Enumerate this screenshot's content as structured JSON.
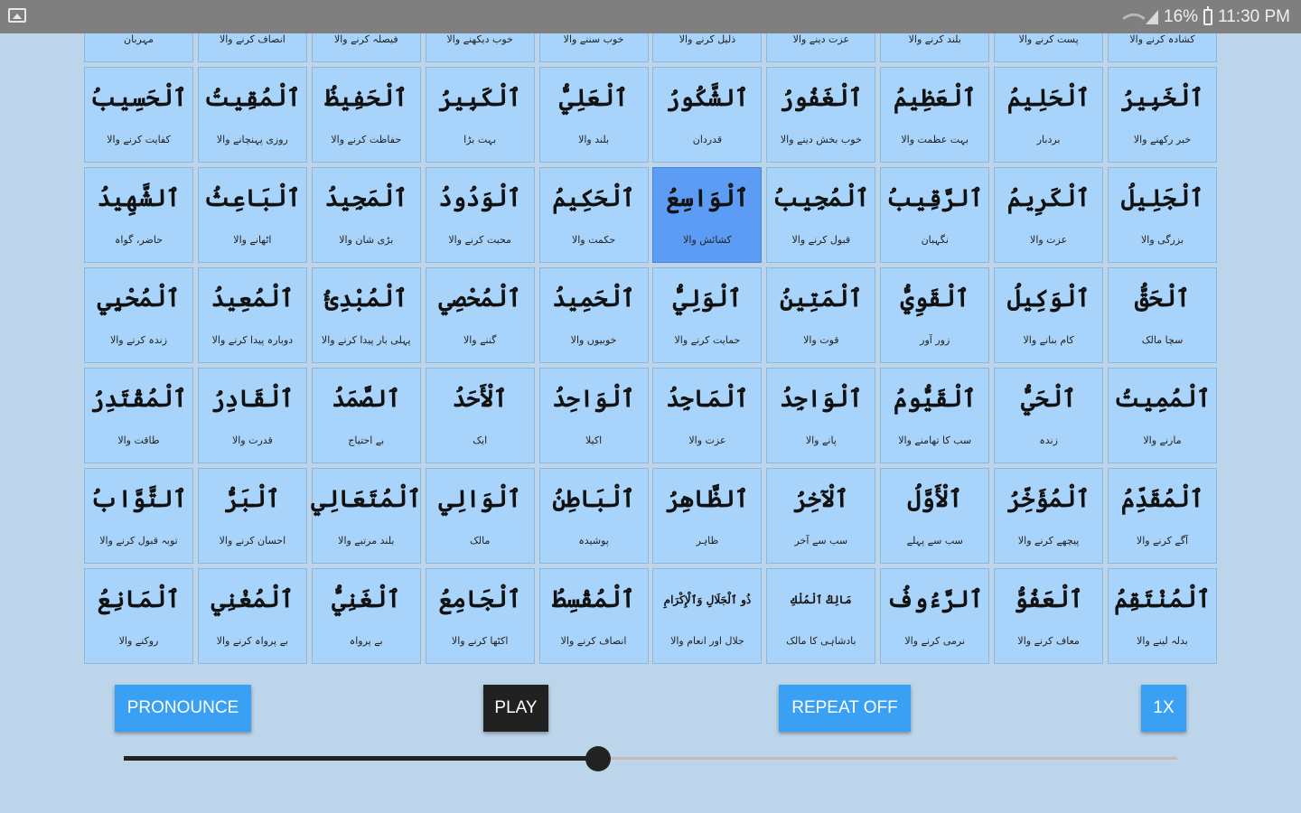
{
  "status_bar": {
    "battery": "16%",
    "time": "11:30 PM"
  },
  "grid": {
    "cells": [
      {
        "name": "",
        "meaning": "مہربان"
      },
      {
        "name": "",
        "meaning": "انصاف کرنے والا"
      },
      {
        "name": "",
        "meaning": "فیصلہ کرنے والا"
      },
      {
        "name": "",
        "meaning": "خوب دیکھنے والا"
      },
      {
        "name": "",
        "meaning": "خوب سننے والا"
      },
      {
        "name": "",
        "meaning": "ذلیل کرنے والا"
      },
      {
        "name": "",
        "meaning": "عزت دینے والا"
      },
      {
        "name": "",
        "meaning": "بلند کرنے والا"
      },
      {
        "name": "",
        "meaning": "پست کرنے والا"
      },
      {
        "name": "",
        "meaning": "کشادہ کرنے والا"
      },
      {
        "name": "ٱلْحَسِيبُ",
        "meaning": "کفایت کرنے والا"
      },
      {
        "name": "ٱلْمُقِيتُ",
        "meaning": "روزی پہنچانے والا"
      },
      {
        "name": "ٱلْحَفِيظُ",
        "meaning": "حفاظت کرنے والا"
      },
      {
        "name": "ٱلْكَبِيرُ",
        "meaning": "بہت بڑا"
      },
      {
        "name": "ٱلْعَلِيُّ",
        "meaning": "بلند والا"
      },
      {
        "name": "ٱلشَّكُورُ",
        "meaning": "قدردان"
      },
      {
        "name": "ٱلْغَفُورُ",
        "meaning": "خوب بخش دینے والا"
      },
      {
        "name": "ٱلْعَظِيمُ",
        "meaning": "بہت عظمت والا"
      },
      {
        "name": "ٱلْحَلِيمُ",
        "meaning": "بردبار"
      },
      {
        "name": "ٱلْخَبِيرُ",
        "meaning": "خبر رکھنے والا"
      },
      {
        "name": "ٱلشَّهِيدُ",
        "meaning": "حاضر، گواہ"
      },
      {
        "name": "ٱلْبَاعِثُ",
        "meaning": "اٹھانے والا"
      },
      {
        "name": "ٱلْمَجِيدُ",
        "meaning": "بڑی شان والا"
      },
      {
        "name": "ٱلْوَدُودُ",
        "meaning": "محبت کرنے والا"
      },
      {
        "name": "ٱلْحَكِيمُ",
        "meaning": "حکمت والا"
      },
      {
        "name": "ٱلْوَاسِعُ",
        "meaning": "کشائش والا"
      },
      {
        "name": "ٱلْمُجِيبُ",
        "meaning": "قبول کرنے والا"
      },
      {
        "name": "ٱلرَّقِيبُ",
        "meaning": "نگہبان"
      },
      {
        "name": "ٱلْكَرِيمُ",
        "meaning": "عزت والا"
      },
      {
        "name": "ٱلْجَلِيلُ",
        "meaning": "بزرگی والا"
      },
      {
        "name": "ٱلْمُحْيِي",
        "meaning": "زندہ کرنے والا"
      },
      {
        "name": "ٱلْمُعِيدُ",
        "meaning": "دوبارہ پیدا کرنے والا"
      },
      {
        "name": "ٱلْمُبْدِئُ",
        "meaning": "پہلی بار پیدا کرنے والا"
      },
      {
        "name": "ٱلْمُحْصِي",
        "meaning": "گننے والا"
      },
      {
        "name": "ٱلْحَمِيدُ",
        "meaning": "خوبیوں والا"
      },
      {
        "name": "ٱلْوَلِيُّ",
        "meaning": "حمایت کرنے والا"
      },
      {
        "name": "ٱلْمَتِينُ",
        "meaning": "قوت والا"
      },
      {
        "name": "ٱلْقَوِيُّ",
        "meaning": "زور آور"
      },
      {
        "name": "ٱلْوَكِيلُ",
        "meaning": "کام بنانے والا"
      },
      {
        "name": "ٱلْحَقُّ",
        "meaning": "سچا مالک"
      },
      {
        "name": "ٱلْمُقْتَدِرُ",
        "meaning": "طاقت والا"
      },
      {
        "name": "ٱلْقَادِرُ",
        "meaning": "قدرت والا"
      },
      {
        "name": "ٱلصَّمَدُ",
        "meaning": "بے احتیاج"
      },
      {
        "name": "ٱلْأَحَدُ",
        "meaning": "ایک"
      },
      {
        "name": "ٱلْوَاحِدُ",
        "meaning": "اکیلا"
      },
      {
        "name": "ٱلْمَاجِدُ",
        "meaning": "عزت والا"
      },
      {
        "name": "ٱلْوَاجِدُ",
        "meaning": "پانے والا"
      },
      {
        "name": "ٱلْقَيُّومُ",
        "meaning": "سب کا تھامنے والا"
      },
      {
        "name": "ٱلْحَيُّ",
        "meaning": "زندہ"
      },
      {
        "name": "ٱلْمُمِيتُ",
        "meaning": "مارنے والا"
      },
      {
        "name": "ٱلتَّوَّابُ",
        "meaning": "توبہ قبول کرنے والا"
      },
      {
        "name": "ٱلْبَرُّ",
        "meaning": "احسان کرنے والا"
      },
      {
        "name": "ٱلْمُتَعَالِي",
        "meaning": "بلند مرتبے والا"
      },
      {
        "name": "ٱلْوَالِي",
        "meaning": "مالک"
      },
      {
        "name": "ٱلْبَاطِنُ",
        "meaning": "پوشیدہ"
      },
      {
        "name": "ٱلظَّاهِرُ",
        "meaning": "ظاہر"
      },
      {
        "name": "ٱلْآخِرُ",
        "meaning": "سب سے آخر"
      },
      {
        "name": "ٱلْأَوَّلُ",
        "meaning": "سب سے پہلے"
      },
      {
        "name": "ٱلْمُؤَخِّرُ",
        "meaning": "پیچھے کرنے والا"
      },
      {
        "name": "ٱلْمُقَدِّمُ",
        "meaning": "آگے کرنے والا"
      },
      {
        "name": "ٱلْمَانِعُ",
        "meaning": "روکنے والا"
      },
      {
        "name": "ٱلْمُغْنِي",
        "meaning": "بے پرواہ کرنے والا"
      },
      {
        "name": "ٱلْغَنِيُّ",
        "meaning": "بے پرواہ"
      },
      {
        "name": "ٱلْجَامِعُ",
        "meaning": "اکٹھا کرنے والا"
      },
      {
        "name": "ٱلْمُقْسِطُ",
        "meaning": "انصاف کرنے والا"
      },
      {
        "name": "ذُو ٱلْجَلَالِ وَٱلْإِكْرَامِ",
        "meaning": "جلال اور انعام والا"
      },
      {
        "name": "مَالِكُ ٱلْمُلْكِ",
        "meaning": "بادشاہی کا مالک"
      },
      {
        "name": "ٱلرَّءُوفُ",
        "meaning": "نرمی کرنے والا"
      },
      {
        "name": "ٱلْعَفُوُّ",
        "meaning": "معاف کرنے والا"
      },
      {
        "name": "ٱلْمُنْتَقِمُ",
        "meaning": "بدلہ لینے والا"
      }
    ],
    "selected_index": 25
  },
  "controls": {
    "pronounce_label": "PRONOUNCE",
    "play_label": "PLAY",
    "repeat_label": "REPEAT OFF",
    "speed_label": "1X",
    "progress": 0.45
  }
}
